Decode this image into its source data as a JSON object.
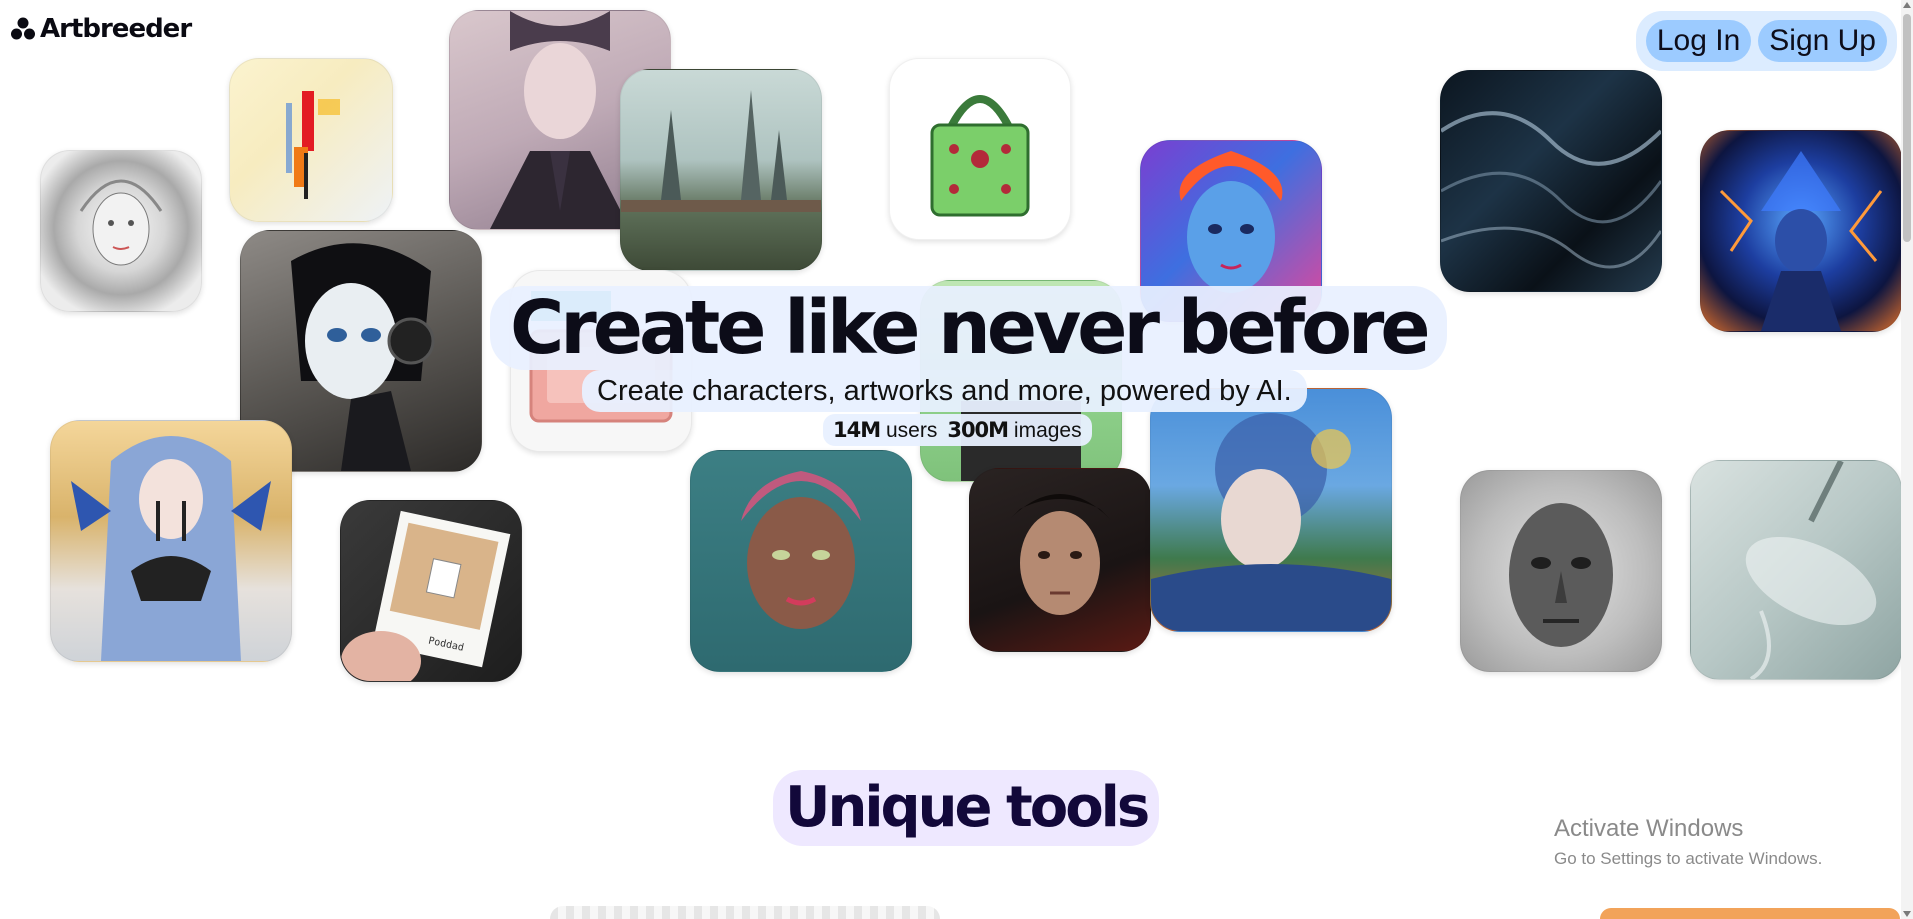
{
  "brand": {
    "name": "Artbreeder",
    "icon": "artbreeder-logo-icon"
  },
  "auth": {
    "login_label": "Log In",
    "signup_label": "Sign Up"
  },
  "hero": {
    "title": "Create like never before",
    "subtitle": "Create characters, artworks and more, powered by AI.",
    "stats": {
      "users_value": "14M",
      "users_label": "users",
      "images_value": "300M",
      "images_label": "images"
    }
  },
  "tools": {
    "title": "Unique tools"
  },
  "os_watermark": {
    "title": "Activate Windows",
    "subtitle": "Go to Settings to activate Windows."
  },
  "gallery": [
    "sketch-girl-portrait",
    "abstract-red-figure",
    "pale-man-in-suit",
    "futuristic-spire-city",
    "green-jeweled-handbag",
    "colorful-boy-portrait",
    "black-silk-waves",
    "blue-lightning-woman",
    "black-android-girl",
    "pink-cosmetic-palette",
    "green-fabric-figure",
    "blue-haired-bird-woman",
    "polaroid-in-hand",
    "pink-haired-girl",
    "dark-haired-man-painting",
    "impressionist-face-landscape",
    "stone-head-sculpture",
    "glass-jellyfish"
  ],
  "colors": {
    "pill": "#e8f0ff",
    "auth_button": "#9ccbff",
    "tools_pill": "#eee8ff"
  }
}
